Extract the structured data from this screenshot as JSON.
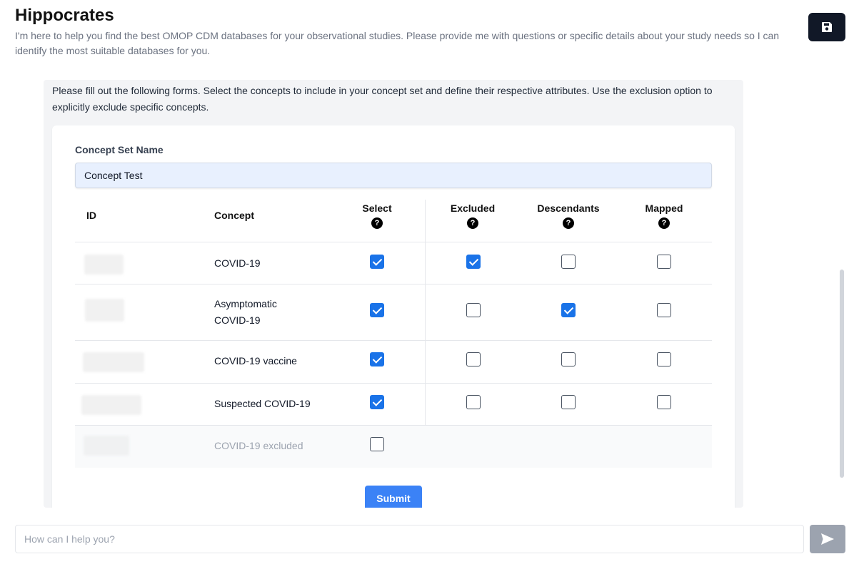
{
  "header": {
    "title": "Hippocrates",
    "subtitle": "I'm here to help you find the best OMOP CDM databases for your observational studies. Please provide me with questions or specific details about your study needs so I can identify the most suitable databases for you.",
    "save_icon": "floppy-disk-icon"
  },
  "chat": {
    "instructions": "Please fill out the following forms. Select the concepts to include in your concept set and define their respective attributes. Use the exclusion option to explicitly exclude specific concepts.",
    "form": {
      "name_label": "Concept Set Name",
      "name_value": "Concept Test",
      "columns": {
        "id": "ID",
        "concept": "Concept",
        "select": "Select",
        "excluded": "Excluded",
        "descendants": "Descendants",
        "mapped": "Mapped"
      },
      "help_icon": "question-circle-icon",
      "rows": [
        {
          "concept": "COVID-19",
          "select": true,
          "excluded": true,
          "descendants": false,
          "mapped": false
        },
        {
          "concept": "Asymptomatic COVID-19",
          "select": true,
          "excluded": false,
          "descendants": true,
          "mapped": false
        },
        {
          "concept": "COVID-19 vaccine",
          "select": true,
          "excluded": false,
          "descendants": false,
          "mapped": false
        },
        {
          "concept": "Suspected COVID-19",
          "select": true,
          "excluded": false,
          "descendants": false,
          "mapped": false
        },
        {
          "concept": "COVID-19 excluded",
          "select": false,
          "disabled": true
        }
      ],
      "submit_label": "Submit"
    }
  },
  "input": {
    "placeholder": "How can I help you?",
    "send_icon": "paper-plane-icon"
  },
  "colors": {
    "accent": "#3b82f6",
    "checkbox_checked": "#1a73e8",
    "save_button": "#111827",
    "send_button": "#9ca3af"
  }
}
